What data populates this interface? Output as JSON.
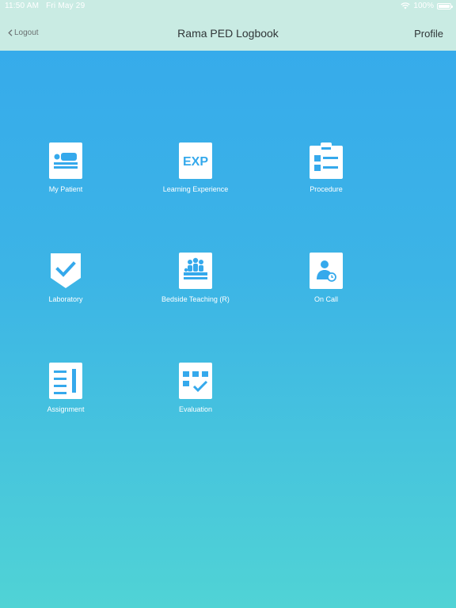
{
  "status_bar": {
    "time": "11:50 AM",
    "date": "Fri May 29",
    "battery": "100%"
  },
  "nav": {
    "back_label": "Logout",
    "title": "Rama PED Logbook",
    "right_label": "Profile"
  },
  "tiles": [
    {
      "label": "My Patient",
      "icon": "patient-bed-icon"
    },
    {
      "label": "Learning Experience",
      "icon": "exp-icon",
      "icon_text": "EXP"
    },
    {
      "label": "Procedure",
      "icon": "clipboard-list-icon"
    },
    {
      "label": "Laboratory",
      "icon": "shield-check-icon"
    },
    {
      "label": "Bedside Teaching (R)",
      "icon": "bedside-group-icon"
    },
    {
      "label": "On Call",
      "icon": "person-clock-icon"
    },
    {
      "label": "Assignment",
      "icon": "document-pencil-icon"
    },
    {
      "label": "Evaluation",
      "icon": "evaluation-grid-check-icon"
    }
  ],
  "colors": {
    "accent": "#35a9ec",
    "accent_bottom": "#50d3d5",
    "header_bg": "#c9ebe3",
    "icon_fg": "#ffffff"
  }
}
